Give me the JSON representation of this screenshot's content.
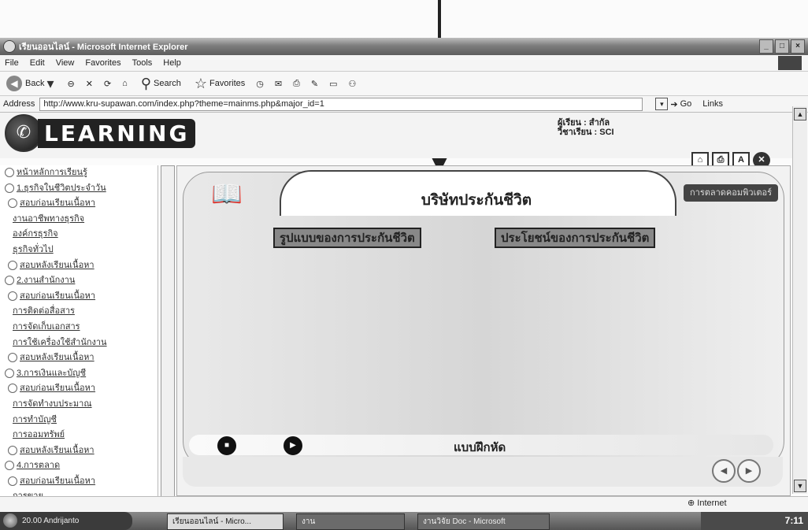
{
  "window": {
    "title": "เรียนออนไลน์ - Microsoft Internet Explorer",
    "min": "_",
    "max": "□",
    "close": "×"
  },
  "menu": [
    "File",
    "Edit",
    "View",
    "Favorites",
    "Tools",
    "Help"
  ],
  "toolbar": {
    "back": "Back",
    "search": "Search",
    "favorites": "Favorites"
  },
  "address": {
    "label": "Address",
    "url": "http://www.kru-supawan.com/index.php?theme=mainms.php&major_id=1",
    "go": "Go",
    "links": "Links"
  },
  "header": {
    "logo_text": "LEARNING",
    "user_line1": "ผู้เรียน : สำกัล",
    "user_line2": "วิชาเรียน : SCI"
  },
  "sidebar": {
    "items": [
      {
        "text": "หน้าหลักการเรียนรู้",
        "level": 0
      },
      {
        "text": "1.ธุรกิจในชีวิตประจำวัน",
        "level": 0
      },
      {
        "text": "สอบก่อนเรียนเนื้อหา",
        "level": 1
      },
      {
        "text": "งานอาชีพทางธุรกิจ",
        "level": 2
      },
      {
        "text": "องค์กรธุรกิจ",
        "level": 2
      },
      {
        "text": "ธุรกิจทั่วไป",
        "level": 2
      },
      {
        "text": "สอบหลังเรียนเนื้อหา",
        "level": 1
      },
      {
        "text": "2.งานสำนักงาน",
        "level": 0
      },
      {
        "text": "สอบก่อนเรียนเนื้อหา",
        "level": 1
      },
      {
        "text": "การติดต่อสื่อสาร",
        "level": 2
      },
      {
        "text": "การจัดเก็บเอกสาร",
        "level": 2
      },
      {
        "text": "การใช้เครื่องใช้สำนักงาน",
        "level": 2
      },
      {
        "text": "สอบหลังเรียนเนื้อหา",
        "level": 1
      },
      {
        "text": "3.การเงินและบัญชี",
        "level": 0
      },
      {
        "text": "สอบก่อนเรียนเนื้อหา",
        "level": 1
      },
      {
        "text": "การจัดทำงบประมาณ",
        "level": 2
      },
      {
        "text": "การทำบัญชี",
        "level": 2
      },
      {
        "text": "การออมทรัพย์",
        "level": 2
      },
      {
        "text": "สอบหลังเรียนเนื้อหา",
        "level": 1
      },
      {
        "text": "4.การตลาด",
        "level": 0
      },
      {
        "text": "สอบก่อนเรียนเนื้อหา",
        "level": 1
      },
      {
        "text": "การขาย",
        "level": 2
      }
    ]
  },
  "content": {
    "title": "บริษัทประกันชีวิต",
    "chip": "การตลาดคอมพิวเตอร์",
    "btn_forms": "รูปแบบของการประกันชีวิต",
    "btn_benefits": "ประโยชน์ของการประกันชีวิต",
    "exercise": "แบบฝึกหัด"
  },
  "status": {
    "left": "",
    "zone": "Internet"
  },
  "taskbar": {
    "start": "20.00 Andrijanto",
    "tasks": [
      "เรียนออนไลน์ - Micro...",
      "งาน",
      "งานวิจัย Doc - Microsoft"
    ],
    "clock": "7:11"
  }
}
